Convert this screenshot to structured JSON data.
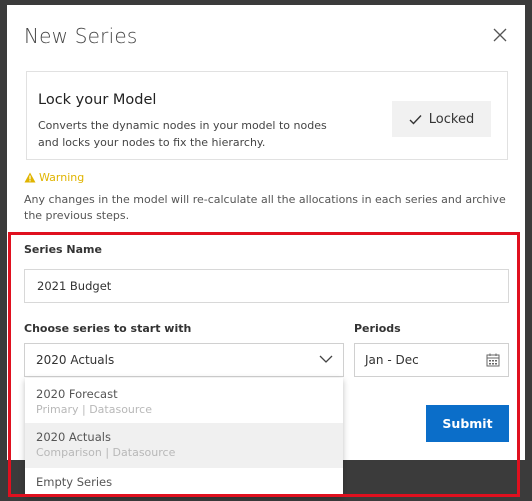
{
  "dialog": {
    "title": "New Series"
  },
  "lock_card": {
    "title": "Lock your Model",
    "description": "Converts the dynamic nodes in your model to nodes and locks your nodes to fix the hierarchy.",
    "button_label": "Locked"
  },
  "warning": {
    "label": "Warning",
    "text": "Any changes in the model will re-calculate all the allocations in each series and archive the previous steps."
  },
  "form": {
    "series_name_label": "Series Name",
    "series_name_value": "2021 Budget",
    "start_with_label": "Choose series to start with",
    "start_with_value": "2020 Actuals",
    "periods_label": "Periods",
    "periods_value": "Jan - Dec",
    "submit_label": "Submit"
  },
  "dropdown": {
    "options": [
      {
        "label": "2020 Forecast",
        "sublabel": "Primary | Datasource",
        "selected": false
      },
      {
        "label": "2020 Actuals",
        "sublabel": "Comparison | Datasource",
        "selected": true
      },
      {
        "label": "Empty Series",
        "sublabel": "",
        "selected": false
      }
    ]
  },
  "colors": {
    "accent": "#0b6ec9",
    "warning": "#e0b400",
    "highlight_frame": "#e0101f",
    "backdrop": "#3b3b3b"
  },
  "icons": {
    "close": "close-icon",
    "check": "check-icon",
    "warning": "warning-triangle-icon",
    "chevron": "chevron-down-icon",
    "calendar": "calendar-icon"
  }
}
